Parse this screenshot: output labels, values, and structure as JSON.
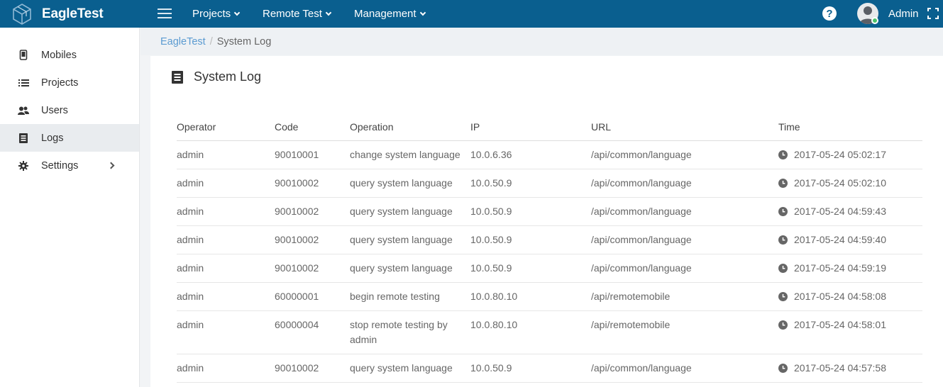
{
  "app": {
    "name": "EagleTest"
  },
  "topnav": [
    {
      "label": "Projects"
    },
    {
      "label": "Remote Test"
    },
    {
      "label": "Management"
    }
  ],
  "user": {
    "name": "Admin"
  },
  "sidebar": {
    "items": [
      {
        "label": "Mobiles",
        "icon": "mobile-icon"
      },
      {
        "label": "Projects",
        "icon": "list-icon"
      },
      {
        "label": "Users",
        "icon": "users-icon"
      },
      {
        "label": "Logs",
        "icon": "log-icon",
        "active": true
      },
      {
        "label": "Settings",
        "icon": "gear-icon"
      }
    ]
  },
  "breadcrumb": {
    "root": "EagleTest",
    "separator": "/",
    "current": "System Log"
  },
  "page": {
    "title": "System Log"
  },
  "table": {
    "columns": [
      "Operator",
      "Code",
      "Operation",
      "IP",
      "URL",
      "Time"
    ],
    "rows": [
      {
        "operator": "admin",
        "code": "90010001",
        "operation": "change system language",
        "ip": "10.0.6.36",
        "url": "/api/common/language",
        "time": "2017-05-24 05:02:17"
      },
      {
        "operator": "admin",
        "code": "90010002",
        "operation": "query system language",
        "ip": "10.0.50.9",
        "url": "/api/common/language",
        "time": "2017-05-24 05:02:10"
      },
      {
        "operator": "admin",
        "code": "90010002",
        "operation": "query system language",
        "ip": "10.0.50.9",
        "url": "/api/common/language",
        "time": "2017-05-24 04:59:43"
      },
      {
        "operator": "admin",
        "code": "90010002",
        "operation": "query system language",
        "ip": "10.0.50.9",
        "url": "/api/common/language",
        "time": "2017-05-24 04:59:40"
      },
      {
        "operator": "admin",
        "code": "90010002",
        "operation": "query system language",
        "ip": "10.0.50.9",
        "url": "/api/common/language",
        "time": "2017-05-24 04:59:19"
      },
      {
        "operator": "admin",
        "code": "60000001",
        "operation": "begin remote testing",
        "ip": "10.0.80.10",
        "url": "/api/remotemobile",
        "time": "2017-05-24 04:58:08"
      },
      {
        "operator": "admin",
        "code": "60000004",
        "operation": "stop remote testing by admin",
        "ip": "10.0.80.10",
        "url": "/api/remotemobile",
        "time": "2017-05-24 04:58:01"
      },
      {
        "operator": "admin",
        "code": "90010002",
        "operation": "query system language",
        "ip": "10.0.50.9",
        "url": "/api/common/language",
        "time": "2017-05-24 04:57:58"
      }
    ]
  },
  "colors": {
    "header": "#0a5f8f",
    "link": "#5b9bd1",
    "online": "#4cc36a"
  }
}
